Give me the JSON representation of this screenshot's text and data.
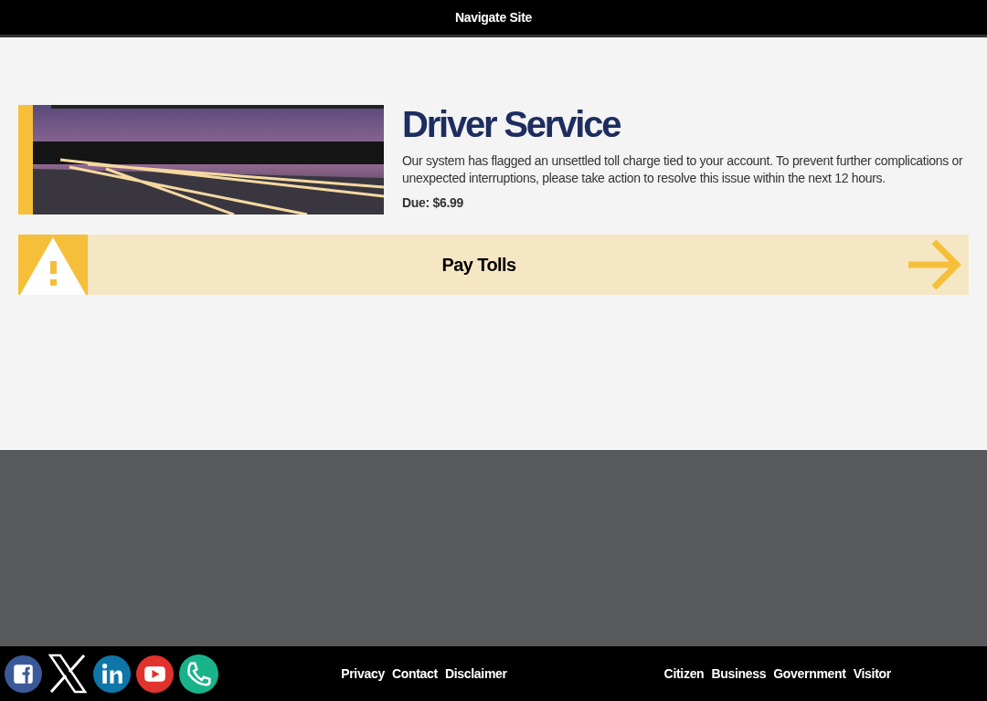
{
  "header": {
    "title": "Navigate Site"
  },
  "service": {
    "title": "Driver Service",
    "message": "Our system has flagged an unsettled toll charge tied to your account. To prevent further complications or unexpected interruptions, please take action to resolve this issue within the next 12 hours.",
    "due": "Due: $6.99"
  },
  "action": {
    "label": "Pay Tolls"
  },
  "footer": {
    "links": [
      "Privacy",
      "Contact",
      "Disclaimer"
    ],
    "audiences": [
      "Citizen",
      "Business",
      "Government",
      "Visitor"
    ]
  }
}
